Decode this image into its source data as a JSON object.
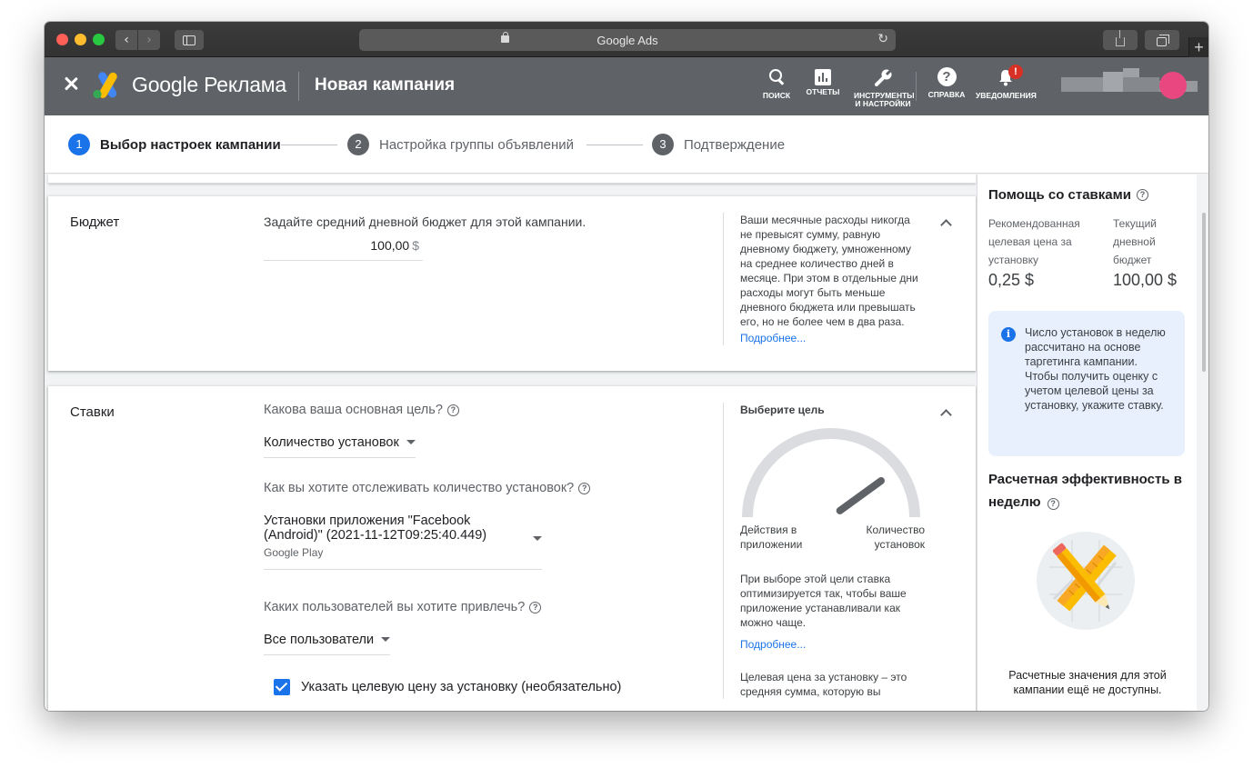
{
  "browser": {
    "url_title": "Google Ads"
  },
  "header": {
    "product_name": "Google Реклама",
    "page_title": "Новая кампания",
    "tools": [
      {
        "label": "ПОИСК",
        "icon": "search-icon"
      },
      {
        "label": "ОТЧЕТЫ",
        "icon": "reports-icon"
      },
      {
        "label": "ИНСТРУМЕНТЫ И НАСТРОЙКИ",
        "icon": "wrench-icon"
      },
      {
        "label": "СПРАВКА",
        "icon": "help-icon"
      },
      {
        "label": "УВЕДОМЛЕНИЯ",
        "icon": "bell-icon",
        "badge": "!"
      }
    ]
  },
  "stepper": {
    "steps": [
      {
        "num": "1",
        "label": "Выбор настроек кампании",
        "active": true
      },
      {
        "num": "2",
        "label": "Настройка группы объявлений",
        "active": false
      },
      {
        "num": "3",
        "label": "Подтверждение",
        "active": false
      }
    ]
  },
  "budget": {
    "title": "Бюджет",
    "label": "Задайте средний дневной бюджет для этой кампании.",
    "value": "100,00",
    "currency": "$",
    "side_text": "Ваши месячные расходы никогда не превысят сумму, равную дневному бюджету, умноженному на среднее количество дней в месяце. При этом в отдельные дни расходы могут быть меньше дневного бюджета или превышать его, но не более чем в два раза.",
    "side_link": "Подробнее..."
  },
  "bids": {
    "title": "Ставки",
    "goal_question": "Какова ваша основная цель?",
    "goal_value": "Количество установок",
    "track_question": "Как вы хотите отслеживать количество установок?",
    "track_value": "Установки приложения \"Facebook (Android)\" (2021-11-12T09:25:40.449)",
    "track_source": "Google Play",
    "users_question": "Каких пользователей вы хотите привлечь?",
    "users_value": "Все пользователи",
    "checkbox_label": "Указать целевую цену за установку (необязательно)",
    "checkbox_checked": true,
    "side_head": "Выберите цель",
    "gauge_left": "Действия в приложении",
    "gauge_right": "Количество установок",
    "gauge_level": 0.8,
    "side_text": "При выборе этой цели ставка оптимизируется так, чтобы ваше приложение устанавливали как можно чаще.",
    "side_link": "Подробнее...",
    "side_text2": "Целевая цена за установку – это средняя сумма, которую вы"
  },
  "right_panel": {
    "title": "Помощь со ставками",
    "col1_label": "Рекомендованная целевая цена за установку",
    "col1_value": "0,25 $",
    "col2_label": "Текущий дневной бюджет",
    "col2_value": "100,00 $",
    "info_text": "Число установок в неделю рассчитано на основе таргетинга кампании. Чтобы получить оценку с учетом целевой цены за установку, укажите ставку.",
    "perf_title": "Расчетная эффективность в неделю",
    "perf_note": "Расчетные значения для этой кампании ещё не доступны."
  },
  "colors": {
    "header_bg": "#5f6368",
    "accent": "#1a73e8",
    "badge": "#d93025"
  }
}
